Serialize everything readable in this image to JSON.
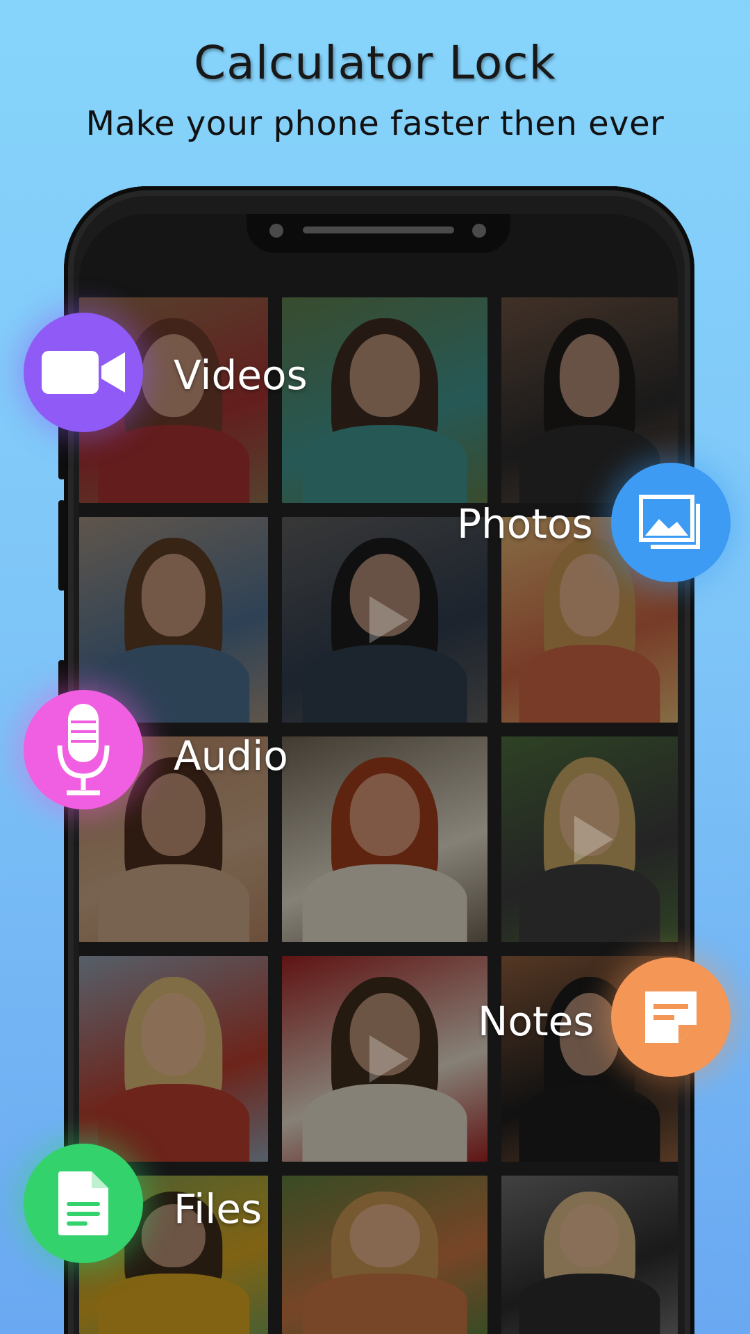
{
  "header": {
    "title": "Calculator Lock",
    "subtitle": "Make your phone faster then ever"
  },
  "features": [
    {
      "key": "videos",
      "label": "Videos",
      "icon": "video-camera-icon",
      "color": "#8f5af5"
    },
    {
      "key": "photos",
      "label": "Photos",
      "icon": "photos-icon",
      "color": "#3d9bf4"
    },
    {
      "key": "audio",
      "label": "Audio",
      "icon": "microphone-icon",
      "color": "#f05fe1"
    },
    {
      "key": "notes",
      "label": "Notes",
      "icon": "note-icon",
      "color": "#f49655"
    },
    {
      "key": "files",
      "label": "Files",
      "icon": "file-icon",
      "color": "#34d26c"
    }
  ],
  "colors": {
    "background_top": "#86d4fb",
    "background_bottom": "#6aa8f1",
    "phone_frame": "#1b1b1b"
  }
}
